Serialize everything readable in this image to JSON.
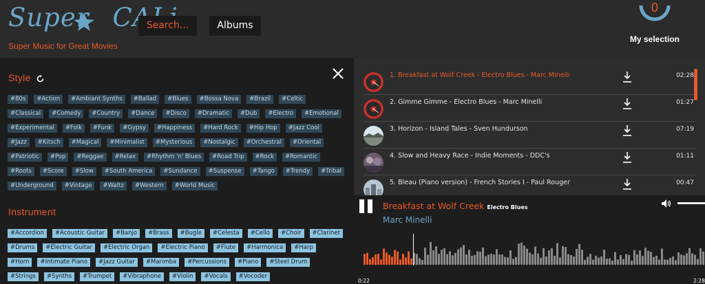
{
  "header": {
    "logo_text": "Super CALi",
    "logo_left": "Super",
    "logo_right": "CALi",
    "tagline": "Super Music for Great Movies",
    "search_label": "Search...",
    "albums_label": "Albums",
    "selection_count": "0",
    "selection_label": "My selection"
  },
  "style_section": {
    "title": "Style",
    "tags": [
      "#80s",
      "#Action",
      "#Ambiant Synths",
      "#Ballad",
      "#Blues",
      "#Bossa Nova",
      "#Brazil",
      "#Celtic",
      "#Classical",
      "#Comedy",
      "#Country",
      "#Dance",
      "#Disco",
      "#Dramatic",
      "#Dub",
      "#Electro",
      "#Emotional",
      "#Experimental",
      "#Folk",
      "#Funk",
      "#Gypsy",
      "#Happiness",
      "#Hard Rock",
      "#Hip Hop",
      "#Jazz Cool",
      "#Jazz",
      "#Kitsch",
      "#Magical",
      "#Minimalist",
      "#Mysterious",
      "#Nostalgic",
      "#Orchestral",
      "#Oriental",
      "#Patriotic",
      "#Pop",
      "#Reggae",
      "#Relax",
      "#Rhythm 'n' Blues",
      "#Road Trip",
      "#Rock",
      "#Romantic",
      "#Roots",
      "#Score",
      "#Slow",
      "#South America",
      "#Sundance",
      "#Suspense",
      "#Tango",
      "#Trendy",
      "#Tribal",
      "#Underground",
      "#Vintage",
      "#Waltz",
      "#Western",
      "#World Music"
    ]
  },
  "instrument_section": {
    "title": "Instrument",
    "tags": [
      "#Accordion",
      "#Acoustic Guitar",
      "#Banjo",
      "#Brass",
      "#Bugle",
      "#Celesta",
      "#Cello",
      "#Choir",
      "#Clarinet",
      "#Drums",
      "#Electric Guitar",
      "#Electric Organ",
      "#Electric Piano",
      "#Flute",
      "#Harmonica",
      "#Harp",
      "#Horn",
      "#Intimate Piano",
      "#Jazz Guitar",
      "#Marimba",
      "#Percussions",
      "#Piano",
      "#Steel Drum",
      "#Strings",
      "#Synths",
      "#Trumpet",
      "#Vibraphone",
      "#Violin",
      "#Vocals",
      "#Vocoder"
    ]
  },
  "playlist": {
    "tracks": [
      {
        "title": "1. Breakfast at Wolf Creek - Electro Blues - Marc Minelli",
        "duration": "02:28",
        "active": true,
        "thumb": "vinyl"
      },
      {
        "title": "2. Gimme Gimme - Electro Blues - Marc Minelli",
        "duration": "01:27",
        "active": false,
        "thumb": "vinyl"
      },
      {
        "title": "3. Horizon - Island Tales - Sven Hundurson",
        "duration": "07:19",
        "active": false,
        "thumb": "landscape"
      },
      {
        "title": "4. Slow and Heavy Race - Indie Moments - DDC's",
        "duration": "01:11",
        "active": false,
        "thumb": "crowd"
      },
      {
        "title": "5. Bleau (Piano version) - French Stories I - Paul Rouger",
        "duration": "00:47",
        "active": false,
        "thumb": "city"
      }
    ]
  },
  "player": {
    "title": "Breakfast at Wolf Creek",
    "album": "Electro Blues",
    "artist": "Marc Minelli",
    "current_time": "0:22",
    "total_time": "2:28",
    "progress_fraction": 0.149,
    "volume_fraction": 1.0
  },
  "colors": {
    "accent": "#e8592a",
    "blue": "#6aa6c9",
    "style_tag_bg": "#2f4757",
    "instrument_tag_bg": "#8cc4e2"
  }
}
